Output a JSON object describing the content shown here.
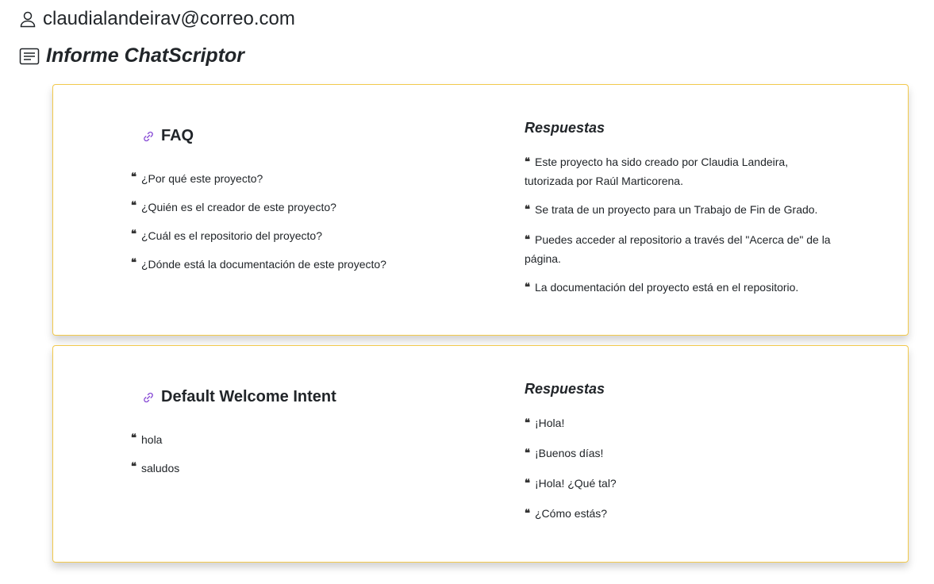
{
  "header": {
    "user_email": "claudialandeirav@correo.com",
    "report_title": "Informe ChatScriptor"
  },
  "intents": [
    {
      "name": "FAQ",
      "questions": [
        "¿Por qué este proyecto?",
        "¿Quién es el creador de este proyecto?",
        "¿Cuál es el repositorio del proyecto?",
        "¿Dónde está la documentación de este proyecto?"
      ],
      "responses_title": "Respuestas",
      "responses": [
        "Este proyecto ha sido creado por Claudia Landeira, tutorizada por Raúl Marticorena.",
        "Se trata de un proyecto para un Trabajo de Fin de Grado.",
        "Puedes acceder al repositorio a través del \"Acerca de\" de la página.",
        "La documentación del proyecto está en el repositorio."
      ]
    },
    {
      "name": "Default Welcome Intent",
      "questions": [
        "hola",
        "saludos"
      ],
      "responses_title": "Respuestas",
      "responses": [
        "¡Hola!",
        "¡Buenos días!",
        "¡Hola! ¿Qué tal?",
        "¿Cómo estás?"
      ]
    }
  ],
  "icons": {
    "user": "user-icon",
    "report": "document-icon",
    "link": "link-icon",
    "quote": "quote-icon"
  },
  "colors": {
    "card_border": "#f2c94c",
    "link_icon": "#8a4fd6",
    "text": "#212529"
  }
}
